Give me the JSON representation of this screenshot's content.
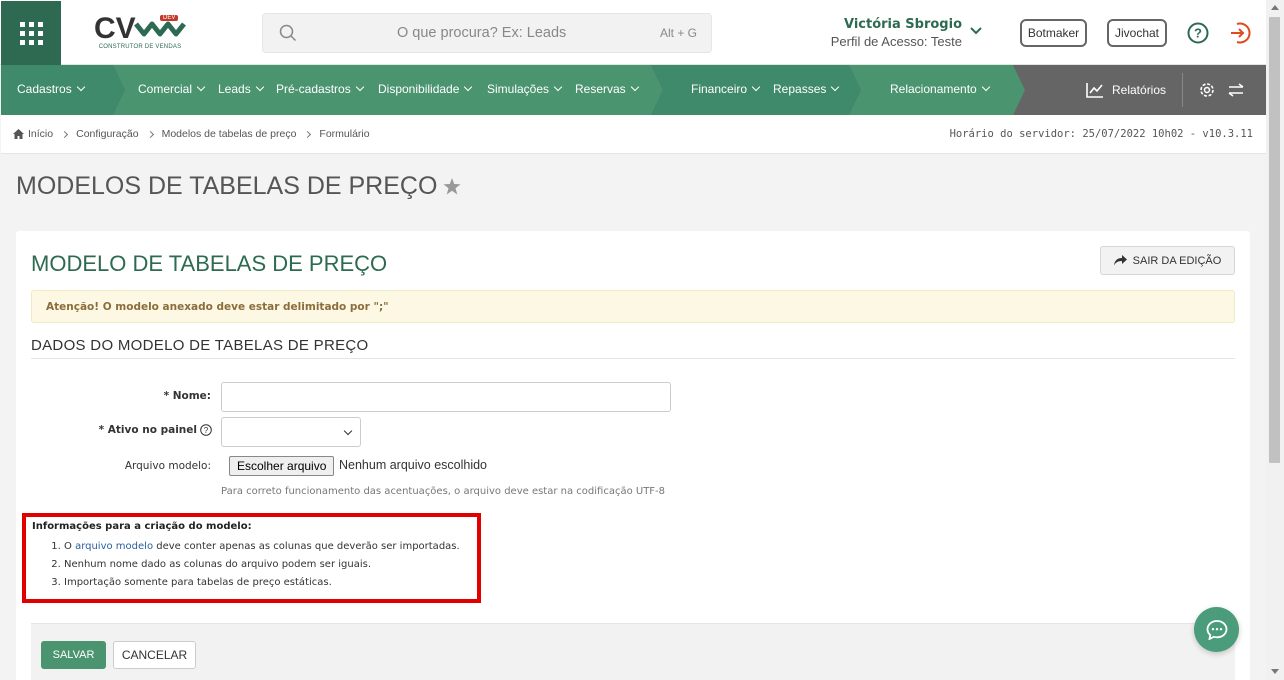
{
  "header": {
    "logo_text": "CV",
    "logo_badge": "DEV",
    "logo_subtitle": "CONSTRUTOR DE VENDAS",
    "search_placeholder": "O que procura? Ex: Leads",
    "search_shortcut": "Alt + G",
    "user_name": "Victória Sbrogio",
    "user_profile": "Perfil de Acesso: Teste",
    "botmaker_label": "Botmaker",
    "jivochat_label": "Jivochat"
  },
  "nav": {
    "items": [
      "Cadastros",
      "Comercial",
      "Leads",
      "Pré-cadastros",
      "Disponibilidade",
      "Simulações",
      "Reservas",
      "Financeiro",
      "Repasses",
      "Relacionamento"
    ],
    "reports_label": "Relatórios"
  },
  "breadcrumb": [
    "Início",
    "Configuração",
    "Modelos de tabelas de preço",
    "Formulário"
  ],
  "server_info": "Horário do servidor: 25/07/2022 10h02 - v10.3.11",
  "page_title": "MODELOS DE TABELAS DE PREÇO",
  "form": {
    "title": "MODELO DE TABELAS DE PREÇO",
    "exit_label": "SAIR DA EDIÇÃO",
    "alert": "Atenção! O modelo anexado deve estar delimitado por \";\"",
    "section": "DADOS DO MODELO DE TABELAS DE PREÇO",
    "name_label": "* Nome:",
    "name_value": "",
    "active_label": "* Ativo no painel",
    "active_value": "",
    "file_label": "Arquivo modelo:",
    "file_button": "Escolher arquivo",
    "file_status": "Nenhum arquivo escolhido",
    "file_help": "Para correto funcionamento das acentuações, o arquivo deve estar na codificação UTF-8",
    "info_title": "Informações para a criação do modelo:",
    "info_1_link": "arquivo modelo",
    "info_1_pre": "O ",
    "info_1_post": " deve conter apenas as colunas que deverão ser importadas.",
    "info_2": "Nenhum nome dado as colunas do arquivo podem ser iguais.",
    "info_3": "Importação somente para tabelas de preço estáticas.",
    "save_label": "SALVAR",
    "cancel_label": "CANCELAR"
  },
  "colors": {
    "brand_green": "#2e6a52",
    "nav_green": "#3f8a6a",
    "alert_bg": "#fcf8e3",
    "highlight_red": "#e00000"
  }
}
